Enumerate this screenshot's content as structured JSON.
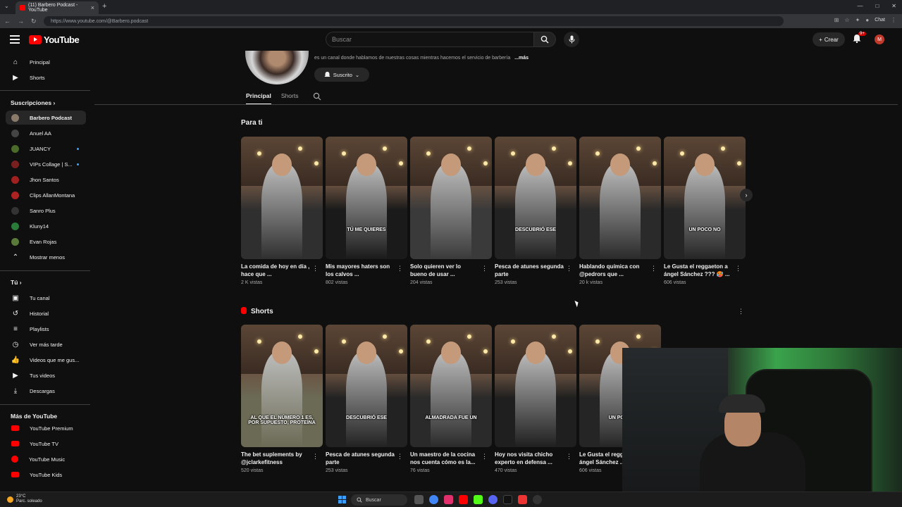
{
  "browser": {
    "tab_title": "(11) Barbero Podcast - YouTube",
    "url": "https://www.youtube.com/@Barbero.podcast",
    "chat_label": "Chat"
  },
  "header": {
    "logo_text": "YouTube",
    "search_placeholder": "Buscar",
    "create_label": "Crear",
    "notif_count": "9+",
    "avatar_letter": "M"
  },
  "sidebar": {
    "main": [
      {
        "label": "Principal",
        "icon": "home-icon"
      },
      {
        "label": "Shorts",
        "icon": "shorts-icon"
      }
    ],
    "subs_title": "Suscripciones",
    "subscriptions": [
      {
        "label": "Barbero Podcast",
        "color": "#8a7a6a",
        "dot": false
      },
      {
        "label": "Anuel AA",
        "color": "#444444",
        "dot": false
      },
      {
        "label": "JUANCY",
        "color": "#4a6b2a",
        "dot": true
      },
      {
        "label": "VIPs Collage | S...",
        "color": "#7a1f1f",
        "dot": true
      },
      {
        "label": "Jhon Santos",
        "color": "#a02020",
        "dot": false
      },
      {
        "label": "Clips AllanMontana",
        "color": "#aa2222",
        "dot": false
      },
      {
        "label": "Sanro Plus",
        "color": "#333333",
        "dot": false
      },
      {
        "label": "Kluny14",
        "color": "#2a7a3a",
        "dot": false
      },
      {
        "label": "Evan Rojas",
        "color": "#5a7a3a",
        "dot": false
      }
    ],
    "show_less": "Mostrar menos",
    "you_title": "Tú",
    "you_items": [
      {
        "label": "Tu canal",
        "icon": "channel-icon"
      },
      {
        "label": "Historial",
        "icon": "history-icon"
      },
      {
        "label": "Playlists",
        "icon": "playlists-icon"
      },
      {
        "label": "Ver más tarde",
        "icon": "clock-icon"
      },
      {
        "label": "Videos que me gus...",
        "icon": "like-icon"
      },
      {
        "label": "Tus videos",
        "icon": "video-icon"
      },
      {
        "label": "Descargas",
        "icon": "download-icon"
      }
    ],
    "more_title": "Más de YouTube",
    "more_items": [
      {
        "label": "YouTube Premium"
      },
      {
        "label": "YouTube TV"
      },
      {
        "label": "YouTube Music"
      },
      {
        "label": "YouTube Kids"
      }
    ]
  },
  "channel": {
    "description": "es un canal donde hablamos de nuestras cosas mientras hacemos el servicio de barbería",
    "more_label": "...más",
    "subscribed_label": "Suscrito",
    "tabs": [
      "Principal",
      "Shorts"
    ]
  },
  "for_you": {
    "title": "Para ti",
    "videos": [
      {
        "title": "La comida de hoy en día , hace que ...",
        "views": "2 K vistas",
        "caption": "",
        "tint": "#2f2f2f"
      },
      {
        "title": "Mis mayores haters son los calvos ...",
        "views": "802 vistas",
        "caption": "TÚ ME QUIERES",
        "tint": "#1a1a1a"
      },
      {
        "title": "Solo quieren ver lo bueno de usar ...",
        "views": "204 vistas",
        "caption": "",
        "tint": "#3a3a3a"
      },
      {
        "title": "Pesca de atunes segunda parte",
        "views": "253 vistas",
        "caption": "DESCUBRIÓ ESE",
        "tint": "#222222"
      },
      {
        "title": "Hablando química con @pedrors que ...",
        "views": "20 k vistas",
        "caption": "",
        "tint": "#2a2a2a"
      },
      {
        "title": "Le Gusta el reggaeton a ángel Sánchez ??? 🥵 ...",
        "views": "606 vistas",
        "caption": "UN POCO NO",
        "tint": "#252525"
      }
    ]
  },
  "shorts": {
    "title": "Shorts",
    "videos": [
      {
        "title": "The bet suplements by @jclarkefitness",
        "views": "520 vistas",
        "caption": "AL QUE EL NÚMERO 1 ES, POR SUPUESTO, PROTEÍNA",
        "tint": "#6b6a55"
      },
      {
        "title": "Pesca de atunes segunda parte",
        "views": "253 vistas",
        "caption": "DESCUBRIÓ ESE",
        "tint": "#222222"
      },
      {
        "title": "Un maestro de la cocina nos cuenta cómo es la...",
        "views": "76 vistas",
        "caption": "ALMADRADA FUE UN",
        "tint": "#2a2a2a"
      },
      {
        "title": "Hoy nos visita chicho experto en defensa ...",
        "views": "470 vistas",
        "caption": "",
        "tint": "#1f1f1f"
      },
      {
        "title": "Le Gusta el reggaeton a ángel Sánchez ...",
        "views": "606 vistas",
        "caption": "UN POCO",
        "tint": "#252525"
      }
    ]
  },
  "taskbar": {
    "temp": "23°C",
    "weather": "Parc. soleado",
    "search": "Buscar"
  }
}
